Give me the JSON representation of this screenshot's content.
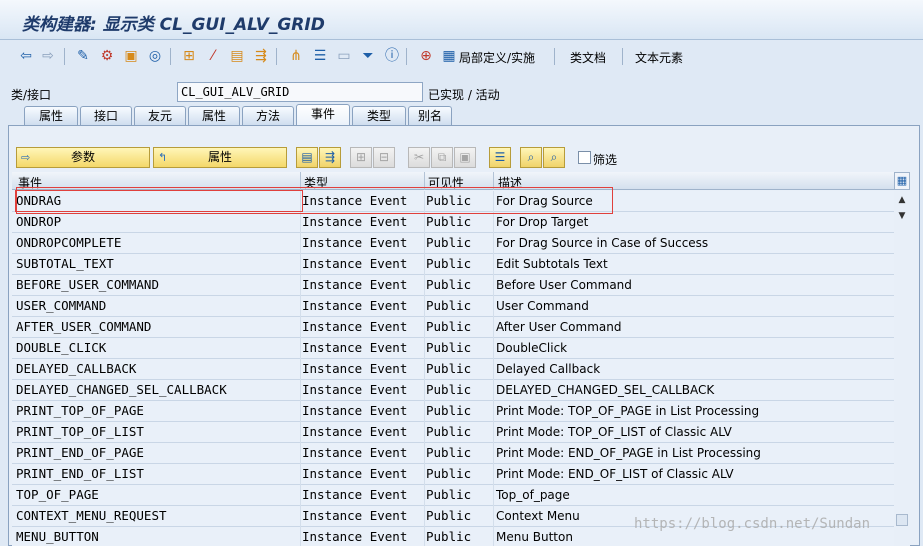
{
  "window": {
    "title": "类构建器: 显示类 CL_GUI_ALV_GRID"
  },
  "toolbar": {
    "local_def_label": "局部定义/实施",
    "class_doc_label": "类文档",
    "text_elements_label": "文本元素"
  },
  "class_row": {
    "label": "类/接口",
    "value": "CL_GUI_ALV_GRID",
    "status": "已实现 / 活动"
  },
  "tabs": [
    {
      "label": "属性"
    },
    {
      "label": "接口"
    },
    {
      "label": "友元"
    },
    {
      "label": "属性"
    },
    {
      "label": "方法"
    },
    {
      "label": "事件"
    },
    {
      "label": "类型"
    },
    {
      "label": "别名"
    }
  ],
  "event_toolbar": {
    "params_label": "参数",
    "attributes_label": "属性",
    "filter_label": "筛选"
  },
  "table": {
    "columns": {
      "event": "事件",
      "type": "类型",
      "visibility": "可见性",
      "description": "描述"
    },
    "rows": [
      {
        "event": "ONDRAG",
        "type": "Instance Event",
        "visibility": "Public",
        "description": "For Drag Source"
      },
      {
        "event": "ONDROP",
        "type": "Instance Event",
        "visibility": "Public",
        "description": "For Drop Target"
      },
      {
        "event": "ONDROPCOMPLETE",
        "type": "Instance Event",
        "visibility": "Public",
        "description": "For Drag Source in Case of Success"
      },
      {
        "event": "SUBTOTAL_TEXT",
        "type": "Instance Event",
        "visibility": "Public",
        "description": "Edit Subtotals Text"
      },
      {
        "event": "BEFORE_USER_COMMAND",
        "type": "Instance Event",
        "visibility": "Public",
        "description": "Before User Command"
      },
      {
        "event": "USER_COMMAND",
        "type": "Instance Event",
        "visibility": "Public",
        "description": "User Command"
      },
      {
        "event": "AFTER_USER_COMMAND",
        "type": "Instance Event",
        "visibility": "Public",
        "description": "After User Command"
      },
      {
        "event": "DOUBLE_CLICK",
        "type": "Instance Event",
        "visibility": "Public",
        "description": "DoubleClick"
      },
      {
        "event": "DELAYED_CALLBACK",
        "type": "Instance Event",
        "visibility": "Public",
        "description": "Delayed Callback"
      },
      {
        "event": "DELAYED_CHANGED_SEL_CALLBACK",
        "type": "Instance Event",
        "visibility": "Public",
        "description": "DELAYED_CHANGED_SEL_CALLBACK"
      },
      {
        "event": "PRINT_TOP_OF_PAGE",
        "type": "Instance Event",
        "visibility": "Public",
        "description": "Print Mode: TOP_OF_PAGE in List Processing"
      },
      {
        "event": "PRINT_TOP_OF_LIST",
        "type": "Instance Event",
        "visibility": "Public",
        "description": "Print Mode: TOP_OF_LIST of Classic ALV"
      },
      {
        "event": "PRINT_END_OF_PAGE",
        "type": "Instance Event",
        "visibility": "Public",
        "description": "Print Mode: END_OF_PAGE in List Processing"
      },
      {
        "event": "PRINT_END_OF_LIST",
        "type": "Instance Event",
        "visibility": "Public",
        "description": "Print Mode: END_OF_LIST of Classic ALV"
      },
      {
        "event": "TOP_OF_PAGE",
        "type": "Instance Event",
        "visibility": "Public",
        "description": "Top_of_page"
      },
      {
        "event": "CONTEXT_MENU_REQUEST",
        "type": "Instance Event",
        "visibility": "Public",
        "description": "Context Menu"
      },
      {
        "event": "MENU_BUTTON",
        "type": "Instance Event",
        "visibility": "Public",
        "description": "Menu Button"
      }
    ]
  },
  "watermark": "https://blog.csdn.net/Sundan",
  "colors": {
    "highlight_box": "#e0403c",
    "accent": "#1e5fa8",
    "button_yellow": "#f4d86a"
  }
}
